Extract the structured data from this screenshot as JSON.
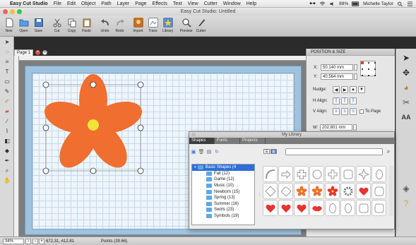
{
  "menubar": {
    "app_name": "Easy Cut Studio",
    "menus": [
      "File",
      "Edit",
      "Object",
      "Path",
      "Layer",
      "Page",
      "Effects",
      "Text",
      "View",
      "Cutter",
      "Window",
      "Help"
    ],
    "battery": "89%",
    "user": "Michelle Taylor"
  },
  "window": {
    "title": "Easy Cut Studio: Untitled"
  },
  "toolbar": {
    "items": [
      "New",
      "Open",
      "Save",
      "Cut",
      "Copy",
      "Paste",
      "Undo",
      "Redo",
      "Import",
      "Trace",
      "Library",
      "Preview",
      "Cutter"
    ]
  },
  "document": {
    "tab_label": "Page 1"
  },
  "position_panel": {
    "header": "POSITION & SIZE",
    "x_label": "X:",
    "x_value": "50.140 mm",
    "y_label": "Y:",
    "y_value": "40.564 mm",
    "nudge_label": "Nudge:",
    "halign_label": "H Align:",
    "valign_label": "V Align:",
    "to_page_label": "To Page",
    "w_label": "W:",
    "w_value": "202.801 mm"
  },
  "library": {
    "title": "My Library",
    "tabs": [
      "Shapes",
      "Fonts",
      "Projects"
    ],
    "tree": [
      "Basic Shapes (4",
      "Fall (12)",
      "Game (12)",
      "Music (10)",
      "Newborn (15)",
      "Spring (13)",
      "Summer (16)",
      "Swirls (23)",
      "Symbols (19)"
    ],
    "search_placeholder": "",
    "shapes": [
      "rounded-arc-shape",
      "arrow-outline-shape",
      "cross-outline-shape",
      "circle-outline-shape",
      "plus-outline-shape",
      "rounded-square-shape",
      "star-four-point-shape",
      "oval-outline-shape",
      "diamond-outline-shape",
      "diamond-rounded-shape",
      "flower-orange-shape",
      "flower-orange-shape",
      "flower-red-shape",
      "gear-shape",
      "heart-red-shape",
      "badge-outline-shape",
      "heart-red-shape",
      "heart-red-shape",
      "heart-red-shape",
      "lips-red-shape",
      "oval-outline-shape",
      "oval-outline-shape",
      "rounded-square-shape",
      "rounded-square-shape"
    ]
  },
  "colors": {
    "flower": "#ef6e30",
    "flower_center": "#f2e23a",
    "accent": "#2d6fd6",
    "heart": "#e8332f"
  },
  "statusbar": {
    "zoom": "34%",
    "coords": "672.31, 412.81",
    "points": "Points (39.66)"
  }
}
